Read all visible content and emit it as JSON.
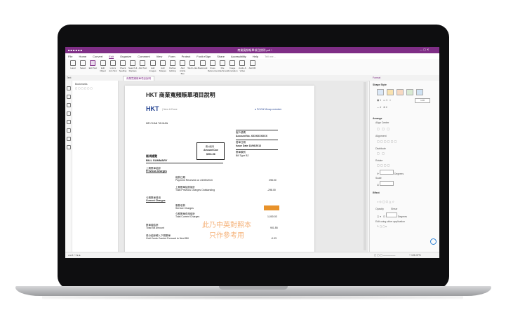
{
  "app": {
    "title": "商業寬頻帳單項目說明.pdf *",
    "menu": [
      "File",
      "Home",
      "Convert",
      "Edit",
      "Organize",
      "Comment",
      "View",
      "Form",
      "Protect",
      "Foxit eSign",
      "Share",
      "Accessibility",
      "Help"
    ],
    "search_placeholder": "Tell me...",
    "toolbar": [
      "Hand",
      "Select",
      "Edit Text",
      "Edit Object",
      "Link & Join Text",
      "Check Spelling",
      "Search & Replace",
      "Add Text",
      "Add Images",
      "Add Shapes",
      "Reflow Editing",
      "Add Article Box",
      "Web Links",
      "Bookmark",
      "Cross Reference",
      "File Attachment",
      "Image Annotation",
      "Audio & Video",
      "Add 3D"
    ],
    "tab_label": "商業寬頻帳單項目說明",
    "left_panel_label": "Bookmarks",
    "right_panel_tab": "Format",
    "status_page": "1 / 1",
    "zoom": "+ 106.37%"
  },
  "doc": {
    "title": "HKT 商業寬頻賬單項目說明",
    "logo": "HKT",
    "logo_sub": "| New & Done",
    "pccw": "a PCCW Group member",
    "address": "MR CHAN TAI MAN",
    "acct_label_zh": "客戶號碼",
    "acct_label": "Account No. XXXXXXXXXX",
    "issue_label_zh": "發單日期",
    "issue_label": "Issue Date 13/06/2013",
    "billtype_zh": "賬單類別",
    "billtype": "Bill Type B2",
    "amount_due_zh": "應付賬項",
    "amount_due": "Amount Due",
    "amount_due_value": "$901.56",
    "summary_zh": "賬項總覽",
    "summary": "BILL SUMMARY",
    "prev_zh": "上期賬單結餘",
    "prev": "Previous Charges",
    "paid_zh": "繳費日期",
    "paid": "Payment Received on 24/05/2013",
    "paid_value": "298.00",
    "outstanding_zh": "上期賬單結餘總計",
    "outstanding": "Total Previous Charges Outstanding",
    "outstanding_value": "-298.00",
    "current_zh": "今期賬單費用",
    "current": "Current Charges",
    "service_zh": "服務收費",
    "service": "Service Charges",
    "total_current_zh": "今期賬單費用總計",
    "total_current": "Total Current Charges",
    "total_current_value": "1,000.03",
    "total_bill_zh": "賬單總結餘",
    "total_bill": "Total Bill Amount",
    "total_bill_value": "901.55",
    "fwd_zh": "角分結餘轉入下期賬單",
    "fwd": "Odd Cents Carried Forward to Next Bill",
    "fwd_value": "-0.03",
    "watermark1": "此乃中英對照本",
    "watermark2": "只作參考用"
  },
  "right": {
    "shape_style": "Shape Style",
    "arrange": "Arrange",
    "align": "Align Center",
    "alignment": "Alignment",
    "distribute": "Distribute",
    "rotate": "Rotate",
    "degrees": "Degrees",
    "scale": "Scale",
    "effect": "Effect",
    "opacity": "Opacity",
    "shear": "Shear",
    "edit_using": "Edit using other application",
    "line_width": "1.00",
    "colors": [
      "#dbe8f7",
      "#f9e2b0",
      "#f7d9c2",
      "#d9ead3",
      "#cfe2f3"
    ]
  }
}
